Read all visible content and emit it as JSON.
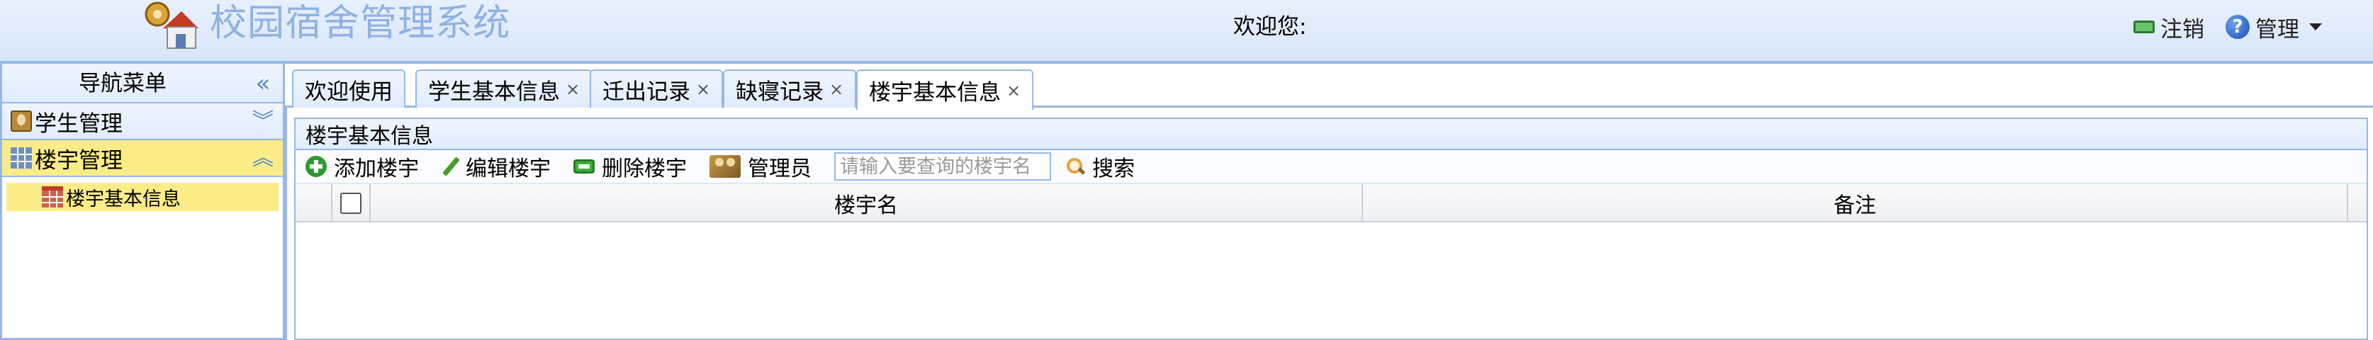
{
  "header": {
    "title": "校园宿舍管理系统",
    "welcome": "欢迎您:",
    "logout_label": "注销",
    "admin_label": "管理"
  },
  "nav": {
    "title": "导航菜单",
    "sections": [
      {
        "label": "学生管理",
        "expanded": false
      },
      {
        "label": "楼宇管理",
        "expanded": true,
        "items": [
          "楼宇基本信息"
        ]
      }
    ]
  },
  "tabs": [
    {
      "label": "欢迎使用",
      "closable": false
    },
    {
      "label": "学生基本信息",
      "closable": true
    },
    {
      "label": "迁出记录",
      "closable": true
    },
    {
      "label": "缺寝记录",
      "closable": true
    },
    {
      "label": "楼宇基本信息",
      "closable": true,
      "active": true
    }
  ],
  "panel": {
    "title": "楼宇基本信息",
    "toolbar": {
      "add": "添加楼宇",
      "edit": "编辑楼宇",
      "delete": "删除楼宇",
      "manager": "管理员",
      "search_placeholder": "请输入要查询的楼宇名",
      "search": "搜索"
    },
    "grid": {
      "columns": [
        "楼宇名",
        "备注"
      ],
      "rows": []
    }
  },
  "colors": {
    "header_bg": "#dae7fa",
    "border": "#95b8e7",
    "title": "#8fb2e2",
    "selected": "#fbec88"
  }
}
